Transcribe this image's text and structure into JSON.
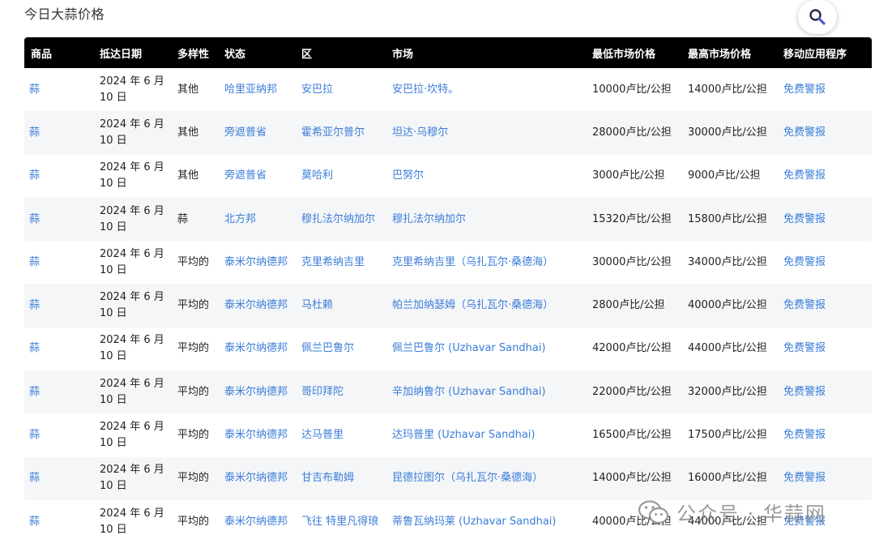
{
  "page": {
    "title": "今日大蒜价格"
  },
  "search": {
    "icon": "search-icon"
  },
  "table": {
    "headers": [
      "商品",
      "抵达日期",
      "多样性",
      "状态",
      "区",
      "市场",
      "最低市场价格",
      "最高市场价格",
      "移动应用程序"
    ],
    "rows": [
      {
        "commodity": "蒜",
        "date_line1": "2024 年 6 月",
        "date_line2": "10 日",
        "variety": "其他",
        "state": "哈里亚纳邦",
        "district": "安巴拉",
        "market": "安巴拉·坎特。",
        "min_price": "10000卢比/公担",
        "max_price": "14000卢比/公担",
        "app": "免费警报"
      },
      {
        "commodity": "蒜",
        "date_line1": "2024 年 6 月",
        "date_line2": "10 日",
        "variety": "其他",
        "state": "旁遮普省",
        "district": "霍希亚尔普尔",
        "market": "坦达·乌穆尔",
        "min_price": "28000卢比/公担",
        "max_price": "30000卢比/公担",
        "app": "免费警报"
      },
      {
        "commodity": "蒜",
        "date_line1": "2024 年 6 月",
        "date_line2": "10 日",
        "variety": "其他",
        "state": "旁遮普省",
        "district": "莫哈利",
        "market": "巴努尔",
        "min_price": "3000卢比/公担",
        "max_price": "9000卢比/公担",
        "app": "免费警报"
      },
      {
        "commodity": "蒜",
        "date_line1": "2024 年 6 月",
        "date_line2": "10 日",
        "variety": "蒜",
        "state": "北方邦",
        "district": "穆扎法尔纳加尔",
        "market": "穆扎法尔纳加尔",
        "min_price": "15320卢比/公担",
        "max_price": "15800卢比/公担",
        "app": "免费警报"
      },
      {
        "commodity": "蒜",
        "date_line1": "2024 年 6 月",
        "date_line2": "10 日",
        "variety": "平均的",
        "state": "泰米尔纳德邦",
        "district": "克里希纳吉里",
        "market": "克里希纳吉里（乌扎瓦尔·桑德海）",
        "min_price": "30000卢比/公担",
        "max_price": "34000卢比/公担",
        "app": "免费警报"
      },
      {
        "commodity": "蒜",
        "date_line1": "2024 年 6 月",
        "date_line2": "10 日",
        "variety": "平均的",
        "state": "泰米尔纳德邦",
        "district": "马杜赖",
        "market": "帕兰加纳瑟姆（乌扎瓦尔·桑德海）",
        "min_price": "2800卢比/公担",
        "max_price": "40000卢比/公担",
        "app": "免费警报"
      },
      {
        "commodity": "蒜",
        "date_line1": "2024 年 6 月",
        "date_line2": "10 日",
        "variety": "平均的",
        "state": "泰米尔纳德邦",
        "district": "佩兰巴鲁尔",
        "market": "佩兰巴鲁尔 (Uzhavar Sandhai)",
        "min_price": "42000卢比/公担",
        "max_price": "44000卢比/公担",
        "app": "免费警报"
      },
      {
        "commodity": "蒜",
        "date_line1": "2024 年 6 月",
        "date_line2": "10 日",
        "variety": "平均的",
        "state": "泰米尔纳德邦",
        "district": "哥印拜陀",
        "market": "辛加纳鲁尔 (Uzhavar Sandhai)",
        "min_price": "22000卢比/公担",
        "max_price": "32000卢比/公担",
        "app": "免费警报"
      },
      {
        "commodity": "蒜",
        "date_line1": "2024 年 6 月",
        "date_line2": "10 日",
        "variety": "平均的",
        "state": "泰米尔纳德邦",
        "district": "达马普里",
        "market": "达玛普里 (Uzhavar Sandhai)",
        "min_price": "16500卢比/公担",
        "max_price": "17500卢比/公担",
        "app": "免费警报"
      },
      {
        "commodity": "蒜",
        "date_line1": "2024 年 6 月",
        "date_line2": "10 日",
        "variety": "平均的",
        "state": "泰米尔纳德邦",
        "district": "甘吉布勒姆",
        "market": "昆德拉图尔（乌扎瓦尔·桑德海）",
        "min_price": "14000卢比/公担",
        "max_price": "16000卢比/公担",
        "app": "免费警报"
      },
      {
        "commodity": "蒜",
        "date_line1": "2024 年 6 月",
        "date_line2": "10 日",
        "variety": "平均的",
        "state": "泰米尔纳德邦",
        "district": "飞往 特里凡得琅",
        "market": "蒂鲁瓦纳玛莱 (Uzhavar Sandhai)",
        "min_price": "40000卢比/公担",
        "max_price": "44000卢比/公担",
        "app": "免费警报"
      }
    ]
  },
  "watermark": {
    "text": "公众号 · 华蒜网",
    "icon": "wechat-icon"
  },
  "colors": {
    "link": "#3b7dd8",
    "header_bg": "#000000",
    "row_alt": "#f4f6f8"
  }
}
